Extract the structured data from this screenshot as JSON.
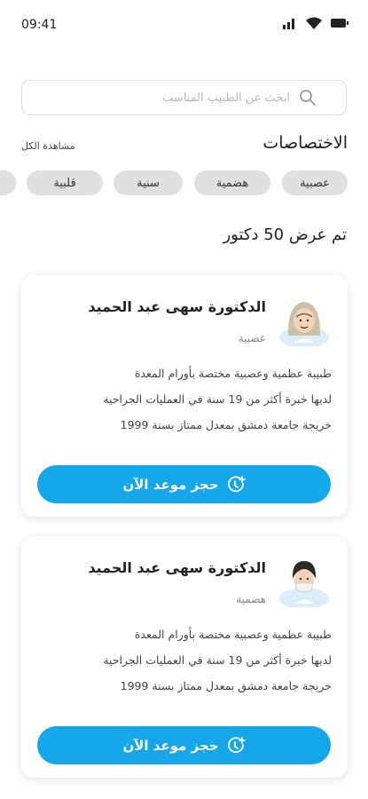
{
  "status_bar": {
    "time": "09:41"
  },
  "search": {
    "placeholder": "ابحث عن الطبيب المناسب"
  },
  "specialties": {
    "title": "الاختصاصات",
    "see_all": "مشاهدة الكل",
    "chips": [
      "عصبية",
      "هضمية",
      "سنية",
      "قلبية"
    ]
  },
  "results_count": "تم عرض 50 دكتور",
  "doctors": [
    {
      "name": "الدكتورة سهى عبد الحميد",
      "specialty": "عصبية",
      "desc_lines": [
        "طبيبة عظمية وعصبية مختصة بأورام المعدة",
        "لديها خبرة أكثر من 19 سنة في العمليات الجراحية",
        "خريجة جامعة دمشق بمعدل ممتاز بسنة 1999"
      ],
      "book_label": "حجز موعد الآن",
      "avatar_icon": "doctor-hijab-avatar-icon"
    },
    {
      "name": "الدكتورة سهى عبد الحميد",
      "specialty": "هضمية",
      "desc_lines": [
        "طبيبة عظمية وعصبية مختصة بأورام المعدة",
        "لديها خبرة أكثر من 19 سنة في العمليات الجراحية",
        "خريجة جامعة دمشق بمعدل ممتاز بسنة 1999"
      ],
      "book_label": "حجز موعد الآن",
      "avatar_icon": "doctor-mask-avatar-icon"
    }
  ],
  "colors": {
    "accent": "#16a7ea",
    "chip_bg": "#e0e0e0"
  }
}
